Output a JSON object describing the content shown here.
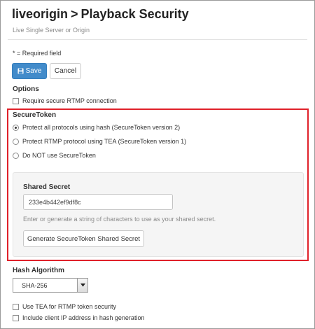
{
  "header": {
    "app": "liveorigin",
    "separator": ">",
    "title": "Playback Security",
    "subtitle": "Live Single Server or Origin"
  },
  "required_note": "* = Required field",
  "toolbar": {
    "save_label": "Save",
    "cancel_label": "Cancel"
  },
  "options": {
    "heading": "Options",
    "secure_rtmp": {
      "label": "Require secure RTMP connection",
      "checked": false
    }
  },
  "securetoken": {
    "heading": "SecureToken",
    "radios": [
      {
        "label": "Protect all protocols using hash (SecureToken version 2)",
        "checked": true
      },
      {
        "label": "Protect RTMP protocol using TEA (SecureToken version 1)",
        "checked": false
      },
      {
        "label": "Do NOT use SecureToken",
        "checked": false
      }
    ],
    "shared_secret": {
      "label": "Shared Secret",
      "value": "233e4b442ef9df8c",
      "help": "Enter or generate a string of characters to use as your shared secret.",
      "generate_label": "Generate SecureToken Shared Secret"
    },
    "highlight_color": "#e0212a"
  },
  "hash_algorithm": {
    "heading": "Hash Algorithm",
    "selected": "SHA-256"
  },
  "extra_options": [
    {
      "label": "Use TEA for RTMP token security",
      "checked": false
    },
    {
      "label": "Include client IP address in hash generation",
      "checked": false
    }
  ],
  "colors": {
    "primary": "#428bca",
    "highlight": "#e0212a"
  },
  "icons": {
    "save": "floppy-disk-icon",
    "dropdown": "chevron-down-icon"
  }
}
